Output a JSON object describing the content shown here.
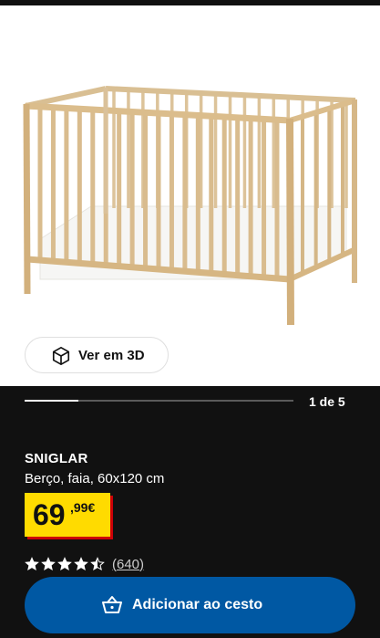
{
  "gallery": {
    "view3d_label": "Ver em 3D",
    "page_indicator": "1 de 5",
    "progress": 0.2
  },
  "product": {
    "name": "SNIGLAR",
    "description": "Berço, faia, 60x120 cm",
    "price_integer": "69",
    "price_decimal": ",99€",
    "rating": 4.5,
    "review_count": "(640)"
  },
  "actions": {
    "add_to_cart_label": "Adicionar ao cesto"
  },
  "colors": {
    "background": "#111111",
    "price_badge": "#ffdb00",
    "price_shadow": "#cc0008",
    "cart_button": "#0058a3"
  },
  "icons": {
    "view3d": "cube-icon",
    "cart": "basket-icon",
    "star": "star-icon"
  }
}
